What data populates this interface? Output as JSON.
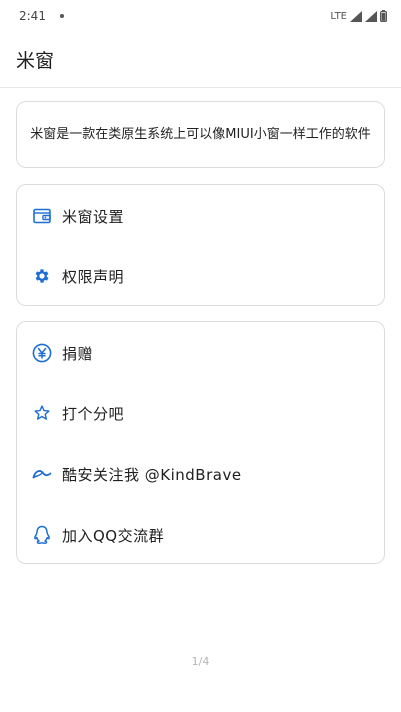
{
  "status": {
    "time": "2:41",
    "network": "LTE"
  },
  "app": {
    "title": "米窗"
  },
  "description": "米窗是一款在类原生系统上可以像MIUI小窗一样工作的软件",
  "settings_card": {
    "items": [
      {
        "label": "米窗设置",
        "icon": "wallet-icon"
      },
      {
        "label": "权限声明",
        "icon": "gear-icon"
      }
    ]
  },
  "misc_card": {
    "items": [
      {
        "label": "捐赠",
        "icon": "yen-icon"
      },
      {
        "label": "打个分吧",
        "icon": "star-icon"
      },
      {
        "label": "酷安关注我 @KindBrave",
        "icon": "coolapk-icon"
      },
      {
        "label": "加入QQ交流群",
        "icon": "qq-icon"
      }
    ]
  },
  "page_indicator": "1/4",
  "colors": {
    "accent": "#1f6fd1",
    "border": "#dcdcdc"
  }
}
